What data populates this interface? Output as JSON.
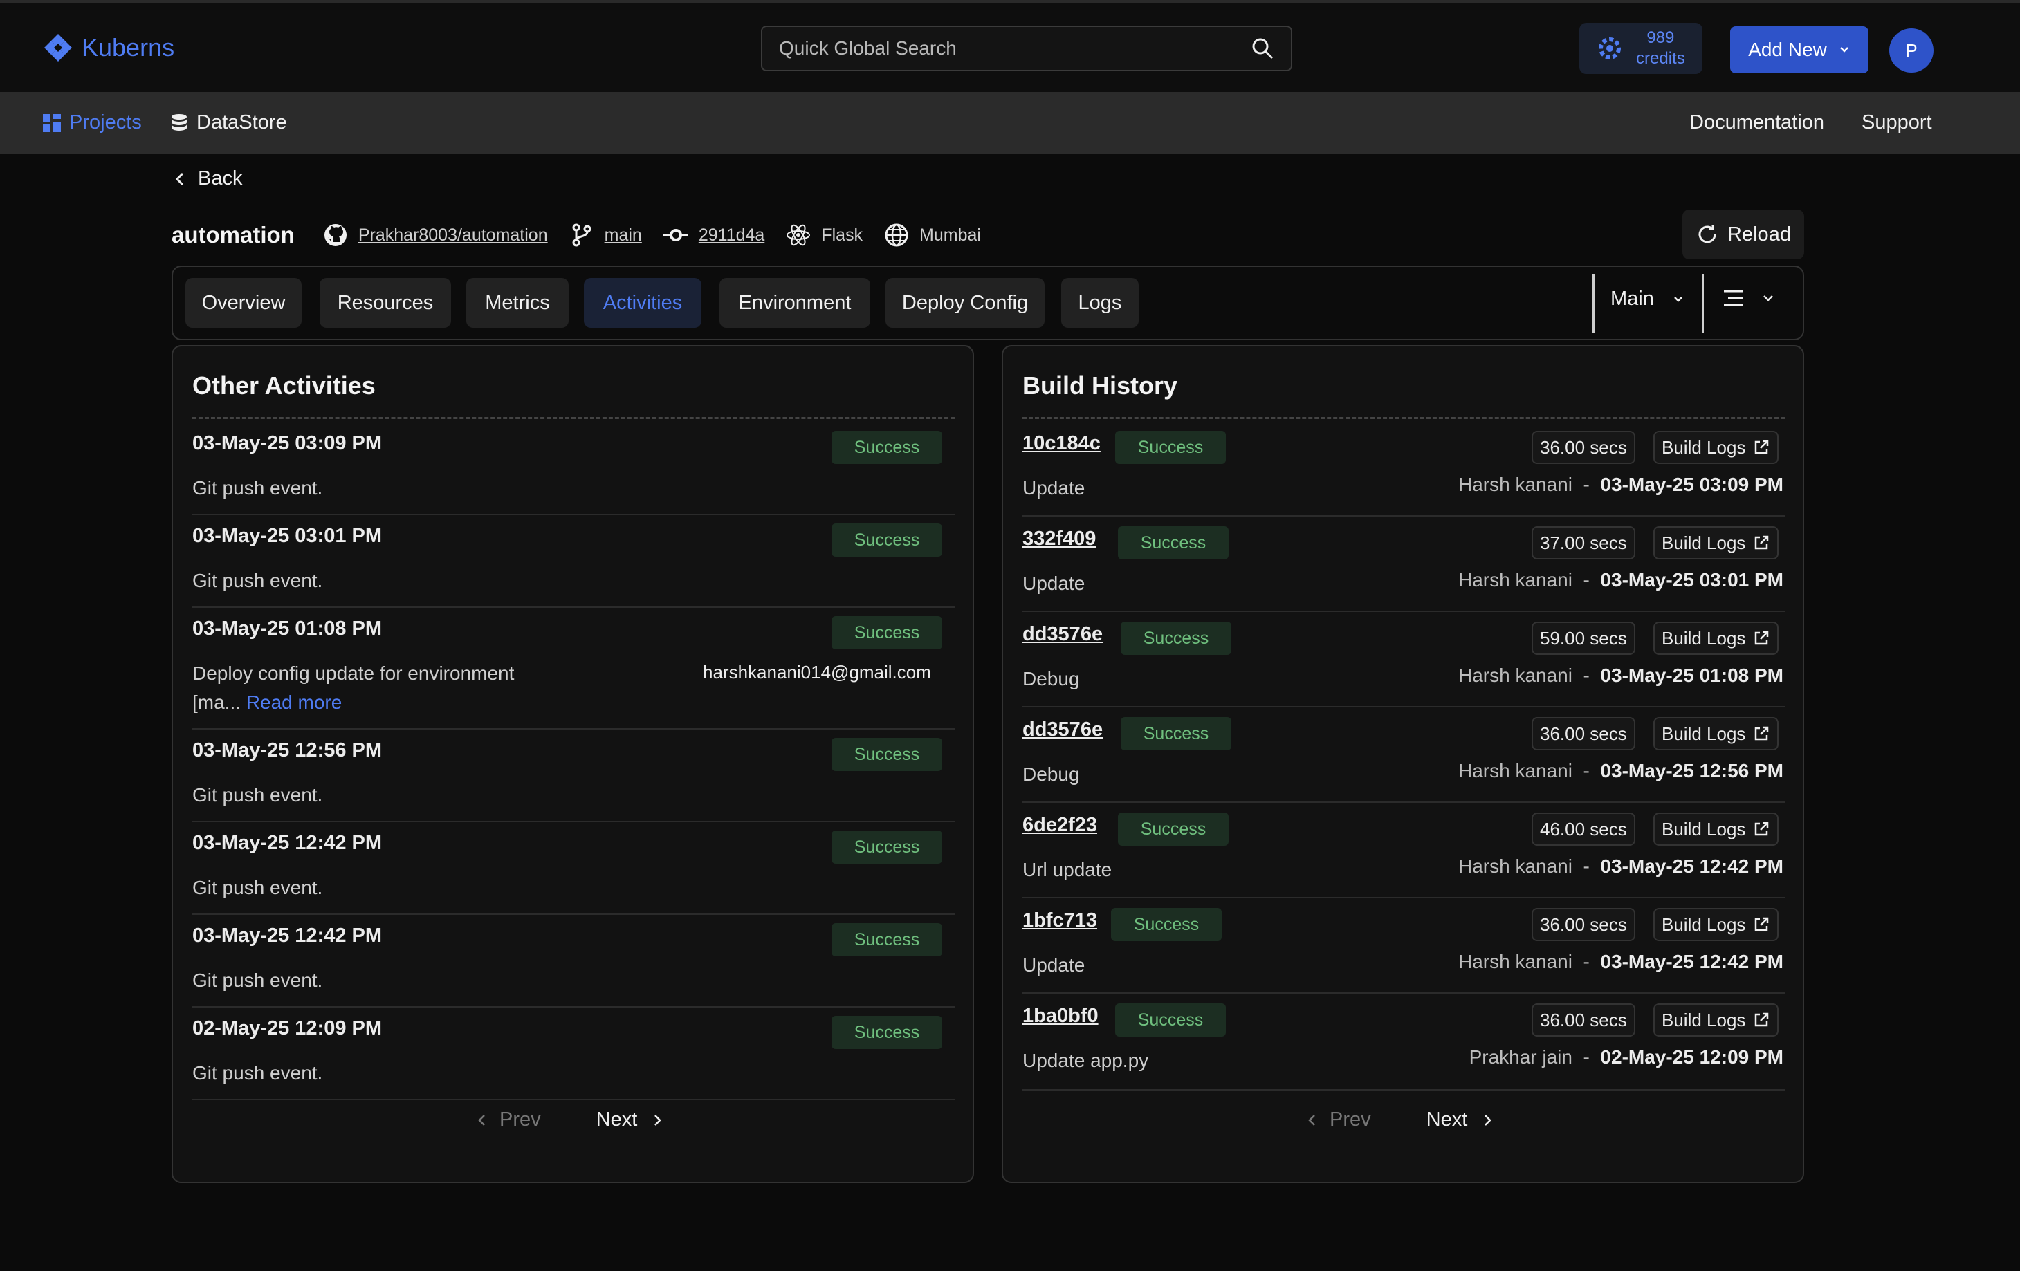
{
  "app": {
    "name": "Kuberns",
    "accent": "#4f7cf2"
  },
  "search": {
    "placeholder": "Quick Global Search"
  },
  "credits": {
    "amount": "989",
    "label": "credits"
  },
  "add_new": "Add New",
  "avatar_initial": "P",
  "nav": {
    "projects": "Projects",
    "datastore": "DataStore",
    "documentation": "Documentation",
    "support": "Support"
  },
  "back": "Back",
  "project": {
    "name": "automation",
    "repo": "Prakhar8003/automation",
    "branch": "main",
    "commit": "2911d4a",
    "framework": "Flask",
    "region": "Mumbai",
    "reload": "Reload"
  },
  "tabs": [
    "Overview",
    "Resources",
    "Metrics",
    "Activities",
    "Environment",
    "Deploy Config",
    "Logs"
  ],
  "active_tab": "Activities",
  "branch_select": "Main",
  "other_activities": {
    "title": "Other Activities",
    "items": [
      {
        "date": "03-May-25 03:09 PM",
        "status": "Success",
        "desc": "Git push event."
      },
      {
        "date": "03-May-25 03:01 PM",
        "status": "Success",
        "desc": "Git push event."
      },
      {
        "date": "03-May-25 01:08 PM",
        "status": "Success",
        "desc_line1": "Deploy config update for environment",
        "desc_line2": "[ma...",
        "read_more": "Read more",
        "email": "harshkanani014@gmail.com"
      },
      {
        "date": "03-May-25 12:56 PM",
        "status": "Success",
        "desc": "Git push event."
      },
      {
        "date": "03-May-25 12:42 PM",
        "status": "Success",
        "desc": "Git push event."
      },
      {
        "date": "03-May-25 12:42 PM",
        "status": "Success",
        "desc": "Git push event."
      },
      {
        "date": "02-May-25 12:09 PM",
        "status": "Success",
        "desc": "Git push event."
      }
    ],
    "prev": "Prev",
    "next": "Next"
  },
  "build_history": {
    "title": "Build History",
    "build_logs_label": "Build Logs",
    "items": [
      {
        "commit": "10c184c",
        "status": "Success",
        "duration": "36.00 secs",
        "message": "Update",
        "author": "Harsh kanani",
        "date": "03-May-25 03:09 PM"
      },
      {
        "commit": "332f409",
        "status": "Success",
        "duration": "37.00 secs",
        "message": "Update",
        "author": "Harsh kanani",
        "date": "03-May-25 03:01 PM"
      },
      {
        "commit": "dd3576e",
        "status": "Success",
        "duration": "59.00 secs",
        "message": "Debug",
        "author": "Harsh kanani",
        "date": "03-May-25 01:08 PM"
      },
      {
        "commit": "dd3576e",
        "status": "Success",
        "duration": "36.00 secs",
        "message": "Debug",
        "author": "Harsh kanani",
        "date": "03-May-25 12:56 PM"
      },
      {
        "commit": "6de2f23",
        "status": "Success",
        "duration": "46.00 secs",
        "message": "Url update",
        "author": "Harsh kanani",
        "date": "03-May-25 12:42 PM"
      },
      {
        "commit": "1bfc713",
        "status": "Success",
        "duration": "36.00 secs",
        "message": "Update",
        "author": "Harsh kanani",
        "date": "03-May-25 12:42 PM"
      },
      {
        "commit": "1ba0bf0",
        "status": "Success",
        "duration": "36.00 secs",
        "message": "Update app.py",
        "author": "Prakhar jain",
        "date": "02-May-25 12:09 PM"
      }
    ],
    "prev": "Prev",
    "next": "Next"
  }
}
